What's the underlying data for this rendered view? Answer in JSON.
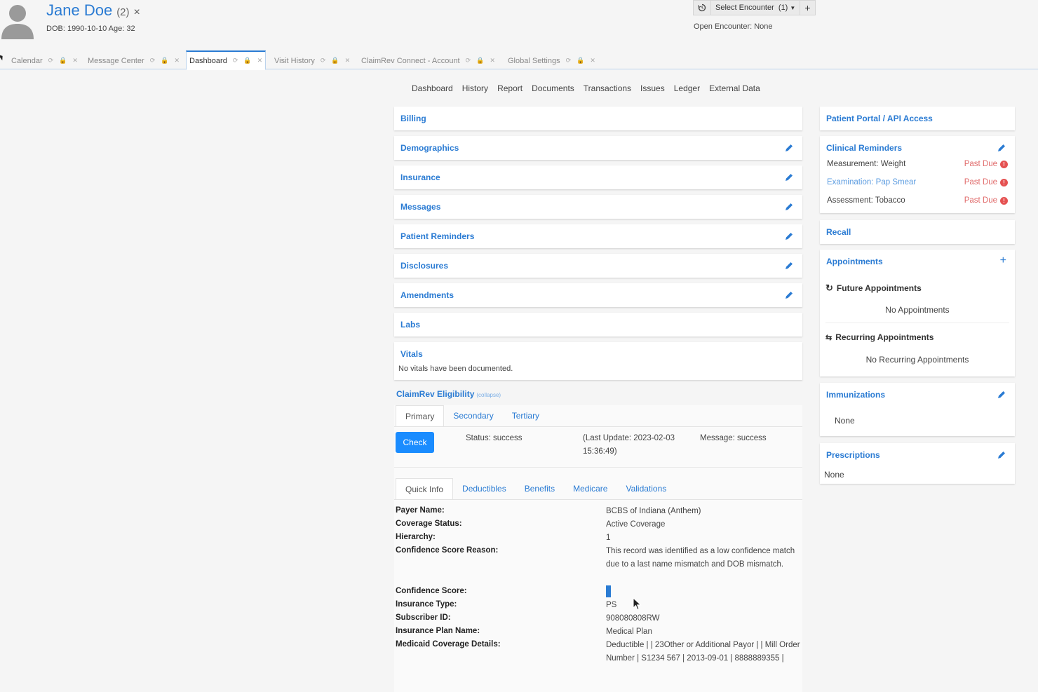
{
  "patient": {
    "name": "Jane Doe",
    "count": "(2)",
    "close": "×",
    "dob": "DOB: 1990-10-10 Age: 32"
  },
  "encounter": {
    "select_label": "Select Encounter",
    "select_count": "(1)",
    "add": "+",
    "open_text": "Open Encounter: None"
  },
  "tabs": [
    {
      "label": "Calendar"
    },
    {
      "label": "Message Center"
    },
    {
      "label": "Dashboard"
    },
    {
      "label": "Visit History"
    },
    {
      "label": "ClaimRev Connect - Account"
    },
    {
      "label": "Global Settings"
    }
  ],
  "subnav": [
    "Dashboard",
    "History",
    "Report",
    "Documents",
    "Transactions",
    "Issues",
    "Ledger",
    "External Data"
  ],
  "left_cards": [
    {
      "title": "Billing"
    },
    {
      "title": "Demographics"
    },
    {
      "title": "Insurance"
    },
    {
      "title": "Messages"
    },
    {
      "title": "Patient Reminders"
    },
    {
      "title": "Disclosures"
    },
    {
      "title": "Amendments"
    },
    {
      "title": "Labs"
    }
  ],
  "vitals": {
    "title": "Vitals",
    "text": "No vitals have been documented."
  },
  "eligibility": {
    "title": "ClaimRev Eligibility",
    "collapse": "(collapse)",
    "tabs": [
      "Primary",
      "Secondary",
      "Tertiary"
    ],
    "check_label": "Check",
    "status": "Status: success",
    "last_update": "(Last Update: 2023-02-03 15:36:49)",
    "message": "Message: success",
    "sub_tabs": [
      "Quick Info",
      "Deductibles",
      "Benefits",
      "Medicare",
      "Validations"
    ],
    "fields": [
      {
        "label": "Payer Name:",
        "value": "BCBS of Indiana (Anthem)"
      },
      {
        "label": "Coverage Status:",
        "value": "Active Coverage"
      },
      {
        "label": "Hierarchy:",
        "value": "1"
      },
      {
        "label": "Confidence Score Reason:",
        "value": "This record was identified as a low confidence match due to a last name mismatch and DOB mismatch."
      },
      {
        "label": "Confidence Score:",
        "value": ""
      },
      {
        "label": "Insurance Type:",
        "value": "PS"
      },
      {
        "label": "Subscriber ID:",
        "value": "908080808RW"
      },
      {
        "label": "Insurance Plan Name:",
        "value": "Medical Plan"
      },
      {
        "label": "Medicaid Coverage Details:",
        "value": "Deductible | | 23Other or Additional Payor | | Mill Order Number | S1234 567 | 2013-09-01 | 8888889355 |"
      }
    ]
  },
  "right": {
    "portal": {
      "title": "Patient Portal / API Access"
    },
    "reminders": {
      "title": "Clinical Reminders",
      "items": [
        {
          "name": "Measurement: Weight",
          "status": "Past Due"
        },
        {
          "name": "Examination: Pap Smear",
          "status": "Past Due"
        },
        {
          "name": "Assessment: Tobacco",
          "status": "Past Due"
        }
      ]
    },
    "recall": {
      "title": "Recall"
    },
    "appointments": {
      "title": "Appointments",
      "add": "+",
      "future_title": "Future Appointments",
      "future_text": "No Appointments",
      "recurring_title": "Recurring Appointments",
      "recurring_text": "No Recurring Appointments"
    },
    "immunizations": {
      "title": "Immunizations",
      "text": "None"
    },
    "prescriptions": {
      "title": "Prescriptions",
      "text": "None"
    }
  },
  "colors": {
    "accent": "#2a7bd3",
    "button": "#1a8cff",
    "past_due": "#e06a6a"
  }
}
